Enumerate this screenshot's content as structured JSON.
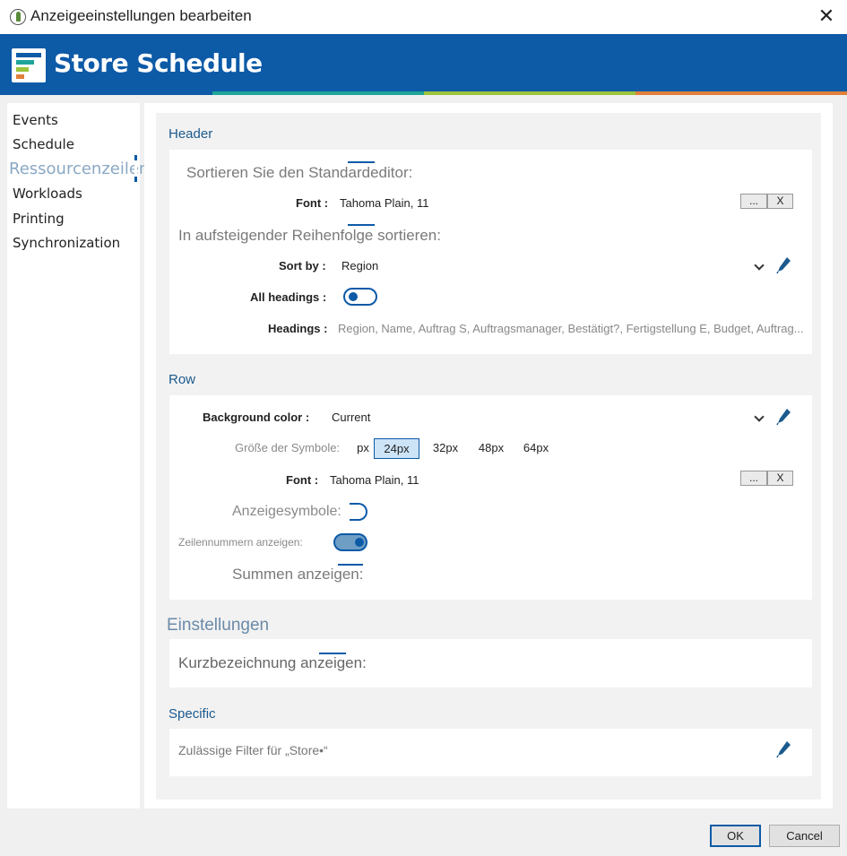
{
  "window": {
    "title": "Anzeigeeinstellungen bearbeiten",
    "close_glyph": "✕",
    "icon": "app-leaf-icon"
  },
  "banner": {
    "brand": "Store Schedule",
    "colors": {
      "background": "#0d5aa7",
      "stripe": [
        "#0d5aa7",
        "#1fa49a",
        "#9bc43b",
        "#e07f3a"
      ]
    }
  },
  "sidebar": {
    "items": [
      {
        "label": "Events"
      },
      {
        "label": "Schedule"
      },
      {
        "label": "Ressourcenzeilen",
        "active": true
      },
      {
        "label": "Workloads"
      },
      {
        "label": "Printing"
      },
      {
        "label": "Synchronization"
      }
    ]
  },
  "header_section": {
    "title": "Header",
    "sort_default_editor": "Sortieren Sie den Standardeditor:",
    "font_label": "Font :",
    "font_value": "Tahoma Plain, 11",
    "more_button": "...",
    "clear_button": "X",
    "ascending_label": "In aufsteigender Reihenfolge sortieren:",
    "sort_by_label": "Sort by :",
    "sort_by_value": "Region",
    "all_headings_label": "All headings :",
    "all_headings_on": false,
    "headings_label": "Headings :",
    "headings_value": "Region, Name, Auftrag S, Auftragsmanager, Bestätigt?, Fertigstellung E, Budget, Auftrag..."
  },
  "row_section": {
    "title": "Row",
    "background_color_label": "Background color :",
    "background_color_value": "Current",
    "icon_size_label": "Größe der Symbole:",
    "icon_sizes": [
      "px",
      "24px",
      "32px",
      "48px",
      "64px"
    ],
    "icon_size_selected": "24px",
    "font_label": "Font :",
    "font_value": "Tahoma Plain, 11",
    "more_button": "...",
    "clear_button": "X",
    "show_icons_label": "Anzeigesymbole:",
    "show_row_numbers_label": "Zeilennummern anzeigen:",
    "show_row_numbers_on": true,
    "show_totals_label": "Summen anzeigen:"
  },
  "settings_section": {
    "title": "Einstellungen",
    "short_name_label": "Kurzbezeichnung anzeigen:"
  },
  "specific_section": {
    "title": "Specific",
    "filters_label": "Zulässige Filter für „Store•“"
  },
  "footer": {
    "ok": "OK",
    "cancel": "Cancel"
  }
}
